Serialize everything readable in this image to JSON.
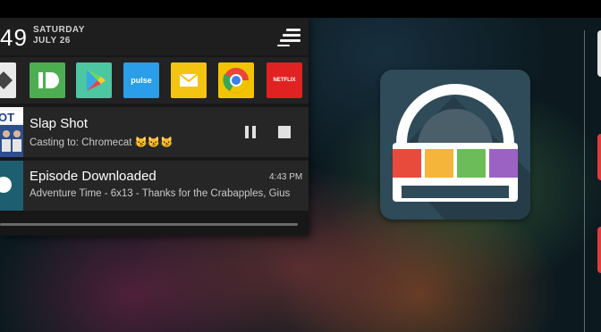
{
  "status": {
    "time": "49",
    "day": "SATURDAY",
    "date": "JULY 26"
  },
  "quick_apps": [
    {
      "name": "app-partial",
      "label": "",
      "color": "#e9e9e9"
    },
    {
      "name": "pushbullet",
      "label": "",
      "color": "#4cae50"
    },
    {
      "name": "google-play",
      "label": "",
      "color": "#4dc7a2"
    },
    {
      "name": "pulse",
      "label": "pulse",
      "color": "#2a9ee8"
    },
    {
      "name": "email",
      "label": "",
      "color": "#f3c412"
    },
    {
      "name": "chrome",
      "label": "",
      "color": "#f2c300"
    },
    {
      "name": "netflix",
      "label": "NETFLIX",
      "color": "#e02222"
    }
  ],
  "notifications": [
    {
      "title": "Slap Shot",
      "subtitle": "Casting to: Chromecat 😼😼😼"
    },
    {
      "title": "Episode Downloaded",
      "subtitle": "Adventure Time - 6x13 - Thanks for the Crabapples, Gius",
      "time": "4:43 PM"
    }
  ],
  "colors": {
    "shade_bg": "#171717",
    "icon_bg": "#2f4a58",
    "swatch_red": "#e84b3c",
    "swatch_yellow": "#f5b43a",
    "swatch_green": "#6cbd5a",
    "swatch_purple": "#9b62c4"
  }
}
